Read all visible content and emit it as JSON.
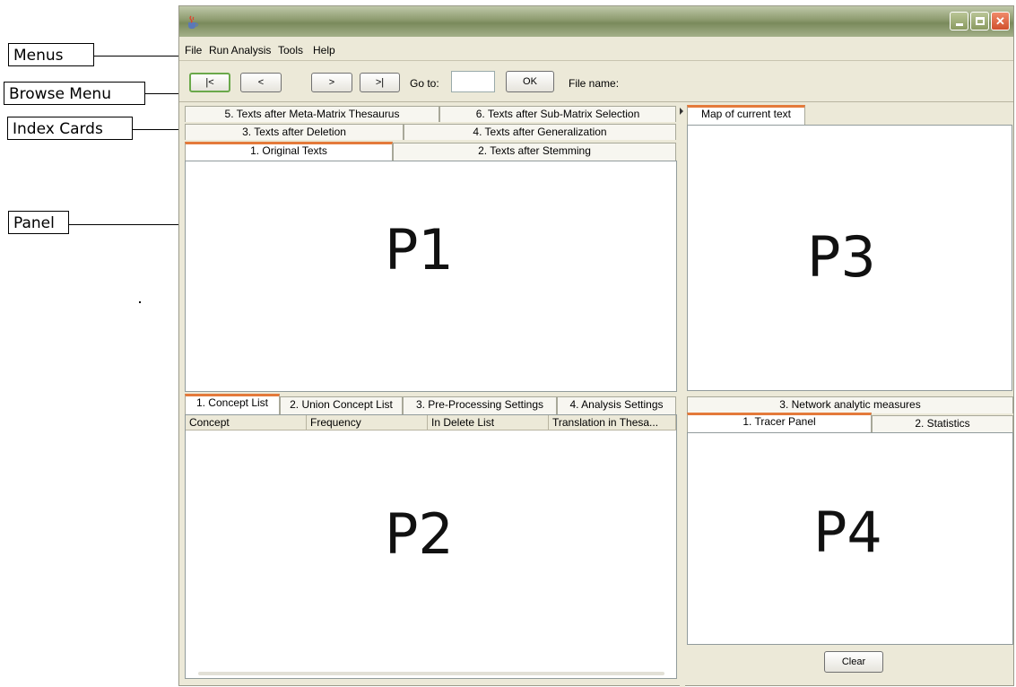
{
  "annotations": {
    "menus": "Menus",
    "browse_menu": "Browse Menu",
    "index_cards": "Index Cards",
    "panel": "Panel"
  },
  "menu": [
    "File",
    "Run Analysis",
    "Tools",
    "Help"
  ],
  "toolbar": {
    "first": "|<",
    "prev": "<",
    "next": ">",
    "last": ">|",
    "goto_label": "Go to:",
    "goto_value": "",
    "ok": "OK",
    "file_name_label": "File name:"
  },
  "p1_tabs": {
    "row1": [
      "5. Texts after Meta-Matrix Thesaurus",
      "6. Texts after Sub-Matrix Selection"
    ],
    "row2": [
      "3. Texts after Deletion",
      "4. Texts after Generalization"
    ],
    "row3": [
      "1. Original Texts",
      "2. Texts after Stemming"
    ]
  },
  "p1_label": "P1",
  "p3_tab": "Map of current text",
  "p3_label": "P3",
  "p2_tabs": [
    "1. Concept List",
    "2. Union Concept List",
    "3. Pre-Processing Settings",
    "4. Analysis Settings"
  ],
  "p2_columns": [
    "Concept",
    "Frequency",
    "In Delete List",
    "Translation in Thesa..."
  ],
  "p2_label": "P2",
  "p4_tabs": {
    "row1": [
      "3. Network analytic measures"
    ],
    "row2": [
      "1. Tracer Panel",
      "2. Statistics"
    ]
  },
  "p4_label": "P4",
  "clear_button": "Clear",
  "colors": {
    "selected_tab_accent": "#e47a3b",
    "window_bg": "#ece9d8"
  }
}
